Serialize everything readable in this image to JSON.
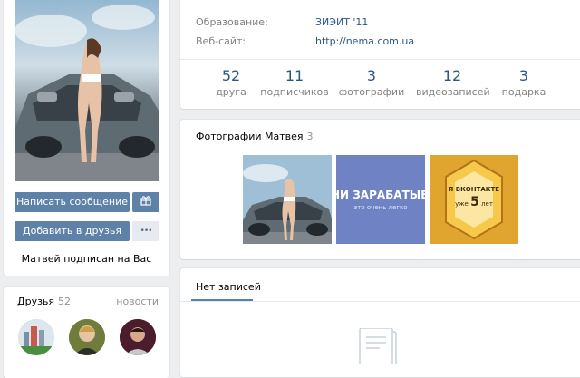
{
  "profile": {
    "send_message_label": "Написать сообщение",
    "add_friend_label": "Добавить в друзья",
    "more_label": "•••",
    "subscribed_text": "Матвей подписан на Вас"
  },
  "info": {
    "education_label": "Образование:",
    "education_value": "ЗИЭИТ '11",
    "website_label": "Веб-сайт:",
    "website_value": "http://nema.com.ua"
  },
  "counters": [
    {
      "num": "52",
      "label": "друга"
    },
    {
      "num": "11",
      "label": "подписчиков"
    },
    {
      "num": "3",
      "label": "фотографии"
    },
    {
      "num": "12",
      "label": "видеозаписей"
    },
    {
      "num": "3",
      "label": "подарка"
    }
  ],
  "photos": {
    "title": "Фотографии Матвея",
    "count": "3",
    "thumb2_text": "НИ ЗАРАБАТЫВ",
    "thumb2_sub": "это очень легко",
    "thumb3_line1": "Я ВКОНТАКТЕ",
    "thumb3_prefix": "уже",
    "thumb3_num": "5",
    "thumb3_suffix": "лет"
  },
  "friends": {
    "title": "Друзья",
    "count": "52",
    "news_label": "новости"
  },
  "wall": {
    "tab_label": "Нет записей"
  },
  "colors": {
    "accent": "#5e81a8",
    "link": "#2a5885",
    "background": "#edeef0"
  }
}
